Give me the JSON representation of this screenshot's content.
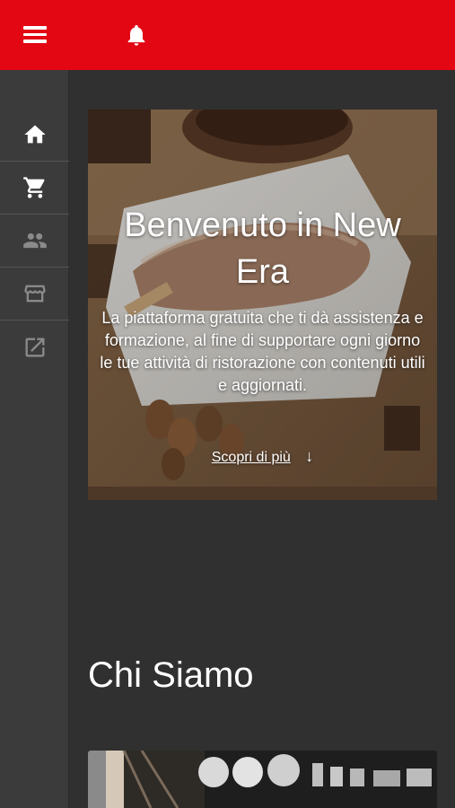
{
  "header": {
    "menu_icon": "hamburger-menu-icon",
    "bell_icon": "bell-icon",
    "background_color": "#e30613"
  },
  "sidebar": {
    "items": [
      {
        "icon": "home-icon",
        "active": true
      },
      {
        "icon": "cart-icon",
        "active": true
      },
      {
        "icon": "people-icon",
        "active": false
      },
      {
        "icon": "store-icon",
        "active": false
      },
      {
        "icon": "external-link-icon",
        "active": false
      }
    ]
  },
  "hero": {
    "title": "Benvenuto in New Era",
    "description": "La piattaforma gratuita che ti dà assistenza e formazione, al fine di supportare ogni giorno le tue attività di ristorazione con contenuti utili e aggiornati.",
    "cta_label": "Scopri di più",
    "cta_arrow": "↓"
  },
  "about": {
    "title": "Chi Siamo"
  }
}
